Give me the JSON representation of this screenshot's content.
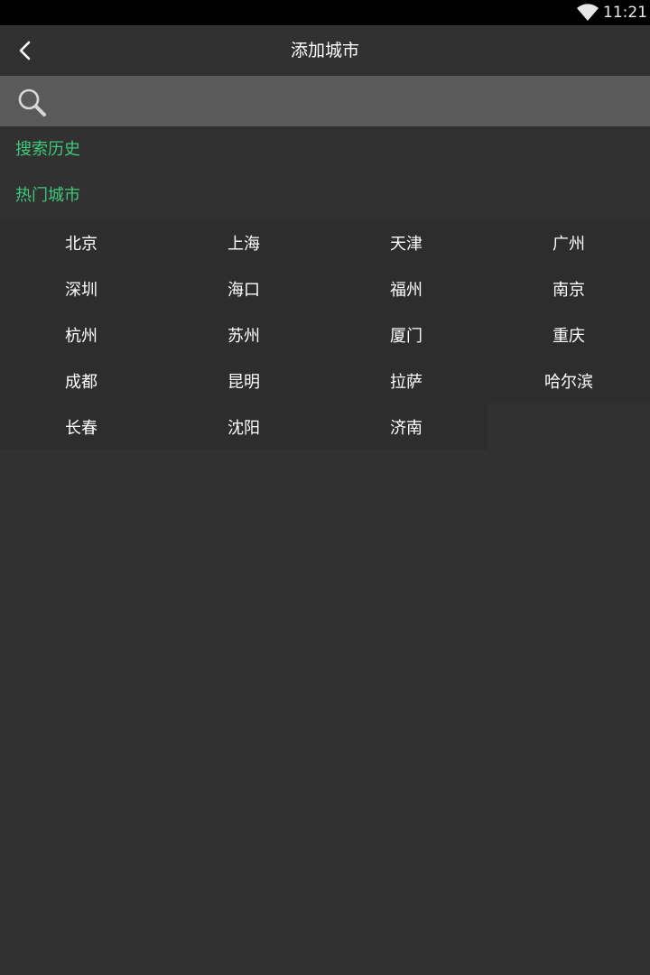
{
  "status_bar": {
    "time": "11:21",
    "wifi_icon": "wifi-icon"
  },
  "header": {
    "title": "添加城市",
    "back_icon": "back-arrow-icon"
  },
  "search": {
    "icon": "search-icon",
    "value": "",
    "placeholder": ""
  },
  "sections": {
    "history_label": "搜索历史",
    "hot_label": "热门城市"
  },
  "hot_cities": [
    "北京",
    "上海",
    "天津",
    "广州",
    "深圳",
    "海口",
    "福州",
    "南京",
    "杭州",
    "苏州",
    "厦门",
    "重庆",
    "成都",
    "昆明",
    "拉萨",
    "哈尔滨",
    "长春",
    "沈阳",
    "济南"
  ],
  "colors": {
    "background": "#313131",
    "search_bar": "#5a5a5a",
    "accent_green": "#3ec97a",
    "status_bar": "#000000"
  }
}
